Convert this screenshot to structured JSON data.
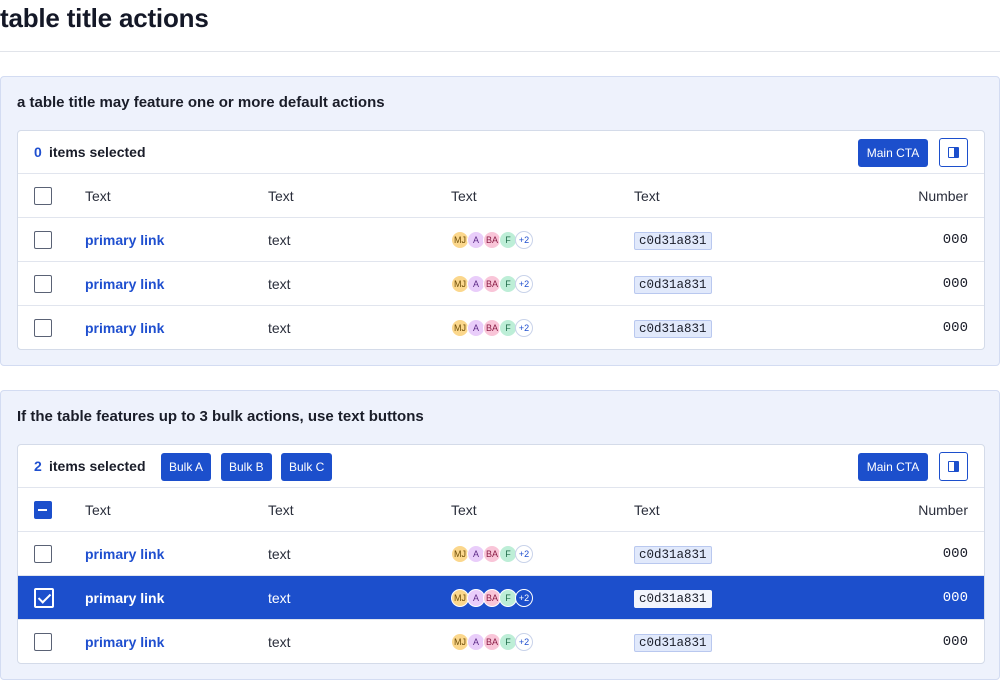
{
  "page": {
    "title": "table title actions"
  },
  "sections": [
    {
      "heading": "a table title may feature one or more default actions",
      "toolbar": {
        "count": "0",
        "count_label": "items selected",
        "bulk_actions": [],
        "main_cta": "Main CTA",
        "columns_icon": "column-layout-icon"
      },
      "headers": [
        "Text",
        "Text",
        "Text",
        "Text",
        "Number"
      ],
      "rows": [
        {
          "checked": false,
          "link": "primary link",
          "text": "text",
          "avatars": [
            "MJ",
            "A",
            "BA",
            "F",
            "+2"
          ],
          "code": "c0d31a831",
          "number": "000"
        },
        {
          "checked": false,
          "link": "primary link",
          "text": "text",
          "avatars": [
            "MJ",
            "A",
            "BA",
            "F",
            "+2"
          ],
          "code": "c0d31a831",
          "number": "000"
        },
        {
          "checked": false,
          "link": "primary link",
          "text": "text",
          "avatars": [
            "MJ",
            "A",
            "BA",
            "F",
            "+2"
          ],
          "code": "c0d31a831",
          "number": "000"
        }
      ]
    },
    {
      "heading": "If the table features up to 3 bulk actions, use text buttons",
      "toolbar": {
        "count": "2",
        "count_label": "items selected",
        "bulk_actions": [
          "Bulk A",
          "Bulk B",
          "Bulk C"
        ],
        "main_cta": "Main CTA",
        "columns_icon": "column-layout-icon"
      },
      "headers": [
        "Text",
        "Text",
        "Text",
        "Text",
        "Number"
      ],
      "rows": [
        {
          "checked": false,
          "link": "primary link",
          "text": "text",
          "avatars": [
            "MJ",
            "A",
            "BA",
            "F",
            "+2"
          ],
          "code": "c0d31a831",
          "number": "000"
        },
        {
          "checked": true,
          "link": "primary link",
          "text": "text",
          "avatars": [
            "MJ",
            "A",
            "BA",
            "F",
            "+2"
          ],
          "code": "c0d31a831",
          "number": "000"
        },
        {
          "checked": false,
          "link": "primary link",
          "text": "text",
          "avatars": [
            "MJ",
            "A",
            "BA",
            "F",
            "+2"
          ],
          "code": "c0d31a831",
          "number": "000"
        }
      ]
    }
  ],
  "colors": {
    "primary": "#1c4fcc",
    "section_bg": "#eef2fc"
  }
}
